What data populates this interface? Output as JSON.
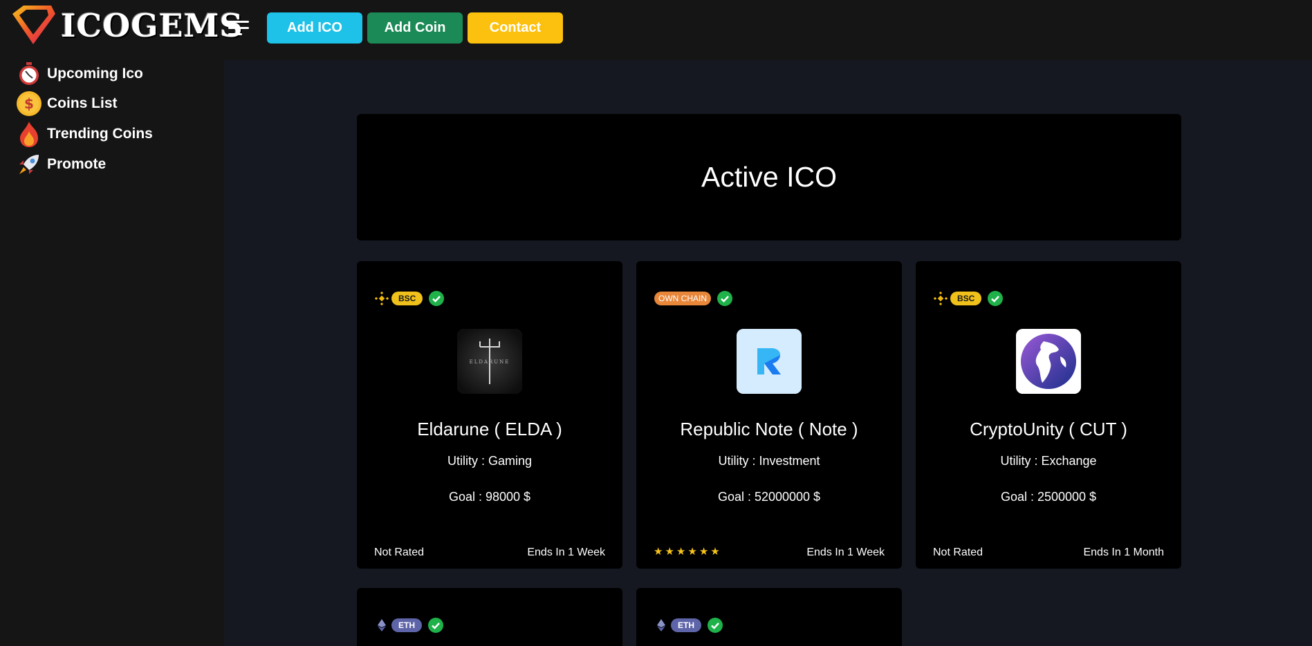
{
  "brand": {
    "name": "ICOGEMS"
  },
  "header": {
    "buttons": {
      "add_ico": "Add ICO",
      "add_coin": "Add Coin",
      "contact": "Contact"
    }
  },
  "sidebar": {
    "items": [
      {
        "label": "Upcoming Ico",
        "icon": "stopwatch-icon"
      },
      {
        "label": "Coins List",
        "icon": "dollar-coin-icon"
      },
      {
        "label": "Trending Coins",
        "icon": "fire-icon"
      },
      {
        "label": "Promote",
        "icon": "rocket-icon"
      }
    ]
  },
  "main": {
    "title": "Active ICO",
    "cards": [
      {
        "chain": "BSC",
        "name": "Eldarune ( ELDA )",
        "utility": "Utility : Gaming",
        "goal": "Goal : 98000 $",
        "rating": "Not Rated",
        "ends": "Ends In 1 Week"
      },
      {
        "chain": "OWN CHAIN",
        "name": "Republic Note ( Note )",
        "utility": "Utility : Investment",
        "goal": "Goal : 52000000 $",
        "rating_stars": 6,
        "ends": "Ends In 1 Week"
      },
      {
        "chain": "BSC",
        "name": "CryptoUnity ( CUT )",
        "utility": "Utility : Exchange",
        "goal": "Goal : 2500000 $",
        "rating": "Not Rated",
        "ends": "Ends In 1 Month"
      },
      {
        "chain": "ETH"
      },
      {
        "chain": "ETH"
      }
    ]
  },
  "colors": {
    "add_ico": "#1ec1e8",
    "add_coin": "#1c8a56",
    "contact": "#fcc10e",
    "bsc": "#f0c11a",
    "own_chain": "#e8863a",
    "eth": "#5e64a8",
    "verified": "#1fb14a",
    "star": "#f7c41b"
  }
}
